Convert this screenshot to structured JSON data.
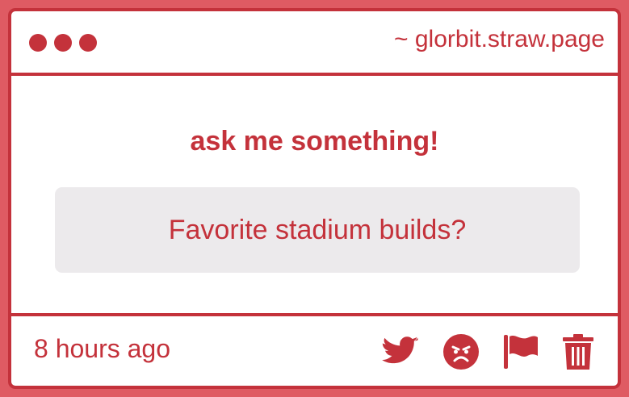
{
  "window": {
    "url": "~ glorbit.straw.page",
    "dots": [
      "dot-1",
      "dot-2",
      "dot-3"
    ]
  },
  "main": {
    "prompt": "ask me something!",
    "question": "Favorite stadium builds?"
  },
  "footer": {
    "timestamp": "8 hours ago",
    "actions": [
      "twitter-icon",
      "angry-face-icon",
      "flag-icon",
      "trash-icon"
    ]
  },
  "colors": {
    "accent": "#c4323b",
    "background": "#df5b63",
    "question_bg": "#eceaec"
  }
}
